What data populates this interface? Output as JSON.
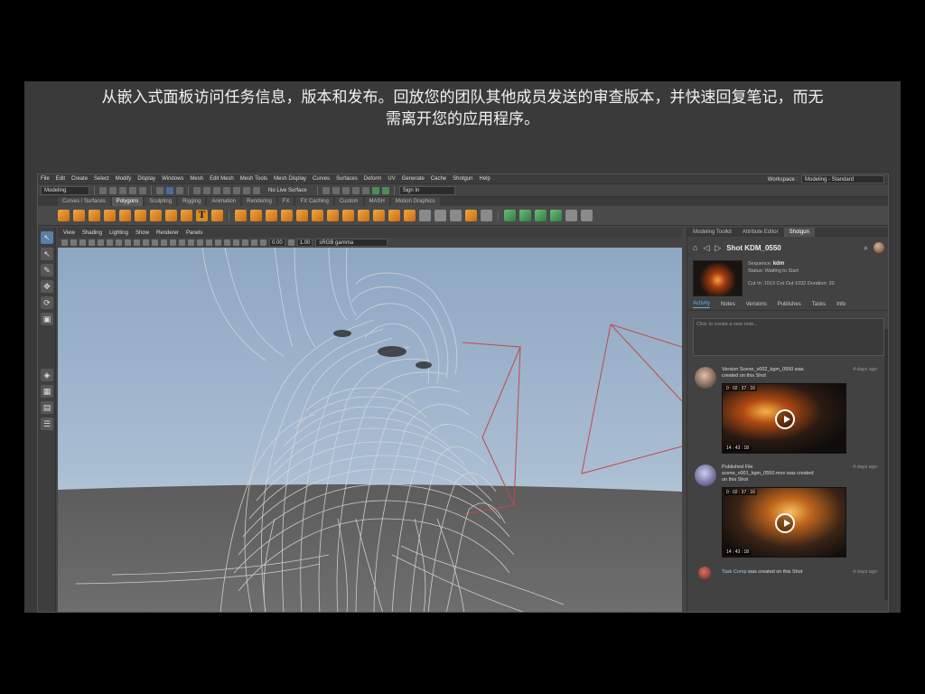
{
  "caption": {
    "line1": "从嵌入式面板访问任务信息，版本和发布。回放您的团队其他成员发送的审查版本，并快速回复笔记，而无",
    "line2": "需离开您的应用程序。"
  },
  "menubar": {
    "items": [
      "File",
      "Edit",
      "Create",
      "Select",
      "Modify",
      "Display",
      "Windows",
      "Mesh",
      "Edit Mesh",
      "Mesh Tools",
      "Mesh Display",
      "Curves",
      "Surfaces",
      "Deform",
      "UV",
      "Generate",
      "Cache",
      "Shotgun",
      "Help"
    ],
    "workspace_label": "Workspace :",
    "workspace_value": "Modeling - Standard"
  },
  "statusline": {
    "mode": "Modeling",
    "live_surface": "No Live Surface",
    "sign_in": "Sign In"
  },
  "shelf": {
    "tabs": [
      "Curves / Surfaces",
      "Polygons",
      "Sculpting",
      "Rigging",
      "Animation",
      "Rendering",
      "FX",
      "FX Caching",
      "Custom",
      "MASH",
      "Motion Graphics"
    ],
    "active_tab": "Polygons"
  },
  "panel": {
    "menu": [
      "View",
      "Shading",
      "Lighting",
      "Show",
      "Renderer",
      "Panels"
    ],
    "exposure": "0.00",
    "gamma_value": "1.00",
    "color_space": "sRGB gamma"
  },
  "shotgun": {
    "tabs": [
      "Modeling Toolkit",
      "Attribute Editor",
      "Shotgun"
    ],
    "active_tab": "Shotgun",
    "shot_title": "Shot KDM_0550",
    "sequence_label": "Sequence:",
    "sequence": "kdm",
    "status": "Status: Waiting to Start",
    "cut": "Cut In: 1013 Cut Out:1032 Duration: 20",
    "subtabs": [
      "Activity",
      "Notes",
      "Versions",
      "Publishes",
      "Tasks",
      "Info"
    ],
    "active_subtab": "Activity",
    "note_placeholder": "Click to create a new note...",
    "activity": [
      {
        "title": "Version Scene_v002_kgm_0550 was",
        "title2": "created on this Shot",
        "age": "4 days ago",
        "tc_top": "0 : 02 : 37 : 16",
        "tc_bottom": "14 : 43 : 18"
      },
      {
        "title": "Published File",
        "title2": "scene_v001_kgm_0550.mov was created",
        "title3": "on this Shot",
        "age": "4 days ago",
        "tc_top": "0 : 02 : 37 : 16",
        "tc_bottom": "14 : 43 : 18"
      }
    ],
    "task_item": {
      "who": "Task Comp",
      "text": "was created on this Shot",
      "age": "4 days ago"
    }
  }
}
